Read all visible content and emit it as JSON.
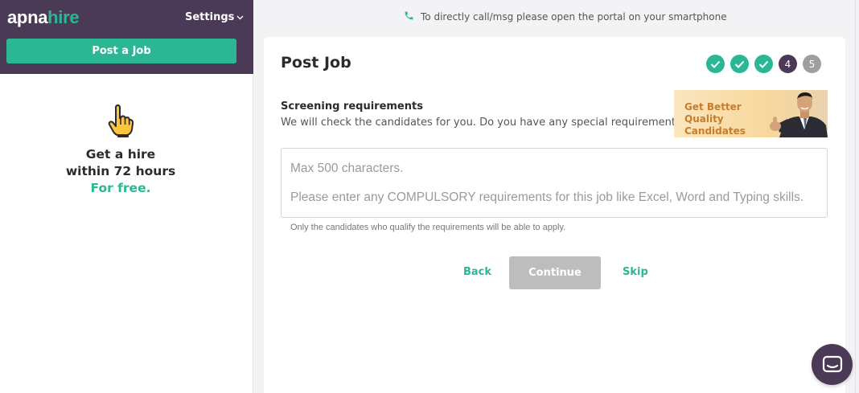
{
  "sidebar": {
    "logo_part1": "apna",
    "logo_part2": "hire",
    "settings_label": "Settings",
    "post_job_label": "Post a Job",
    "promo": {
      "line1": "Get a hire",
      "line2": "within 72 hours",
      "line3": "For free."
    }
  },
  "notice": {
    "text": "To directly call/msg please open the portal on your smartphone"
  },
  "main": {
    "title": "Post Job",
    "steps": [
      {
        "state": "done",
        "label": ""
      },
      {
        "state": "done",
        "label": ""
      },
      {
        "state": "done",
        "label": ""
      },
      {
        "state": "current",
        "label": "4"
      },
      {
        "state": "todo",
        "label": "5"
      }
    ],
    "section_title": "Screening requirements",
    "section_subtitle": "We will check the candidates for you. Do you have any special requirements?",
    "quality_banner": "Get Better Quality Candidates",
    "requirements": {
      "value": "",
      "placeholder_line1": "Max 500 characters.",
      "placeholder_line2": "Please enter any COMPULSORY requirements for this job like Excel, Word and Typing skills."
    },
    "help_text": "Only the candidates who qualify the requirements will be able to apply.",
    "back_label": "Back",
    "continue_label": "Continue",
    "skip_label": "Skip"
  },
  "colors": {
    "brand_purple": "#4b3a56",
    "brand_green": "#2bb793",
    "disabled_gray": "#bdbdbd"
  },
  "icons": [
    "phone-icon",
    "pointing-hand-icon",
    "chevron-down-icon",
    "checkmark-icon",
    "chat-icon"
  ]
}
